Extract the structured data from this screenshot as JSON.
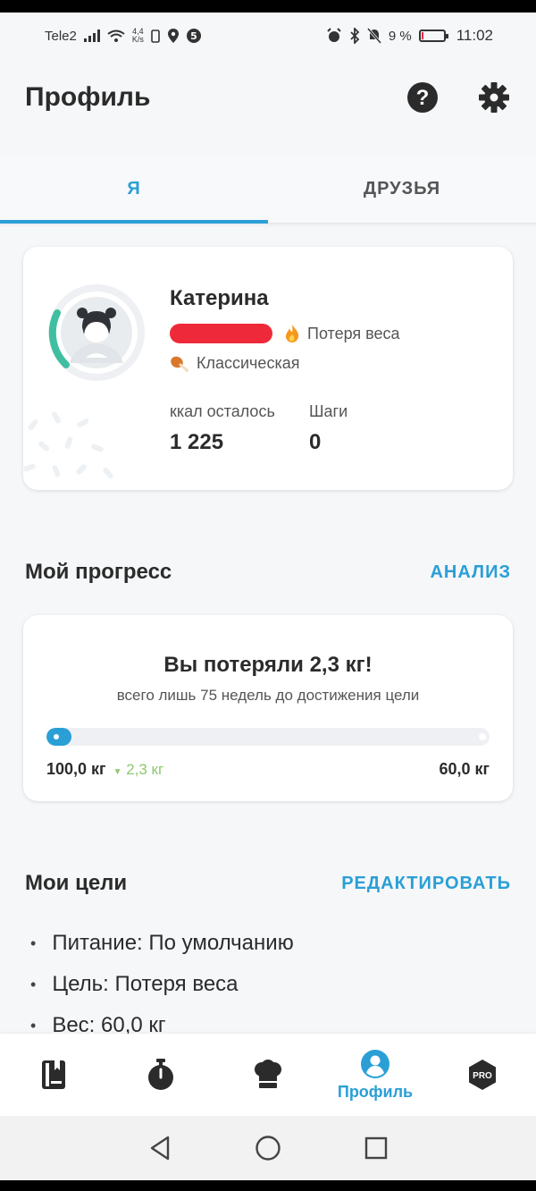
{
  "status_bar": {
    "carrier": "Tele2",
    "speed_value": "4,4",
    "speed_unit": "K/s",
    "battery": "9 %",
    "battery_level": 0.09,
    "time": "11:02"
  },
  "header": {
    "title": "Профиль"
  },
  "tabs": [
    {
      "label": "Я",
      "active": true
    },
    {
      "label": "ДРУЗЬЯ",
      "active": false
    }
  ],
  "profile": {
    "name": "Катерина",
    "goal": "Потеря веса",
    "diet": "Классическая",
    "kcal_label": "ккал осталось",
    "kcal_value": "1 225",
    "steps_label": "Шаги",
    "steps_value": "0"
  },
  "progress_section": {
    "title": "Мой прогресс",
    "link": "АНАЛИЗ",
    "headline": "Вы потеряли 2,3 кг!",
    "subtitle": "всего лишь 75 недель до достижения цели",
    "start_weight": "100,0 кг",
    "lost": "2,3 кг",
    "target_weight": "60,0 кг",
    "progress_fraction": 0.057
  },
  "goals_section": {
    "title": "Мои цели",
    "link": "РЕДАКТИРОВАТЬ",
    "items": [
      {
        "text": "Питание: По умолчанию"
      },
      {
        "text": "Цель: Потеря веса"
      },
      {
        "text": "Вес: 60,0 кг"
      }
    ]
  },
  "bottom_nav": {
    "items": [
      {
        "icon": "diary-icon"
      },
      {
        "icon": "timer-icon"
      },
      {
        "icon": "chef-hat-icon"
      },
      {
        "icon": "profile-icon",
        "label": "Профиль",
        "active": true
      },
      {
        "icon": "pro-icon",
        "badge": "PRO"
      }
    ]
  },
  "colors": {
    "accent": "#2a9fd6",
    "loss_green": "#8cc870",
    "redaction": "#ee2a3a",
    "ring_teal": "#3fbf9f"
  }
}
